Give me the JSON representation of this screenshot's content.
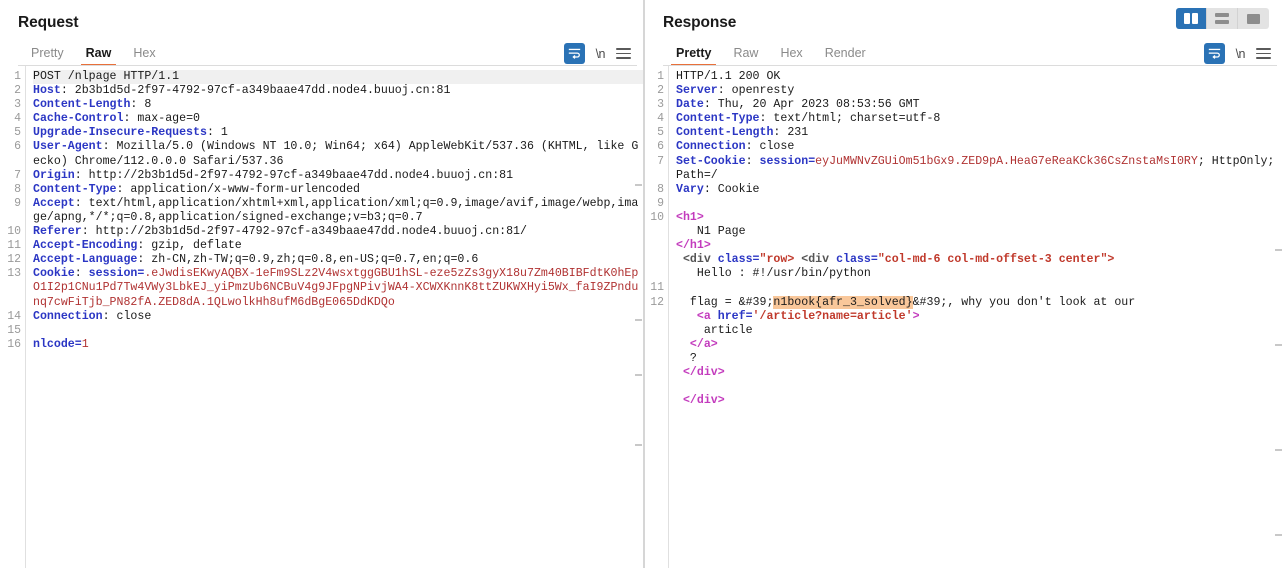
{
  "layout_switch": {
    "buttons": [
      {
        "name": "side-by-side",
        "icon": "columns-icon",
        "active": true
      },
      {
        "name": "stacked",
        "icon": "rows-icon",
        "active": false
      },
      {
        "name": "single",
        "icon": "single-pane-icon",
        "active": false
      }
    ]
  },
  "request": {
    "title": "Request",
    "tabs": [
      {
        "label": "Pretty",
        "active": false
      },
      {
        "label": "Raw",
        "active": true
      },
      {
        "label": "Hex",
        "active": false
      }
    ],
    "tools": [
      {
        "name": "word-wrap-icon",
        "label": ""
      },
      {
        "name": "newline-icon",
        "label": "\\n"
      },
      {
        "name": "menu-icon",
        "label": ""
      }
    ],
    "line_numbers": [
      "1",
      "2",
      "3",
      "4",
      "5",
      "",
      "6",
      "",
      "",
      "7",
      "",
      "8",
      "9",
      "",
      "",
      "",
      "10",
      "",
      "11",
      "12",
      "13",
      "",
      "",
      "",
      "",
      "14",
      "15",
      "",
      "16"
    ],
    "lines": [
      {
        "n": "1",
        "first": true,
        "parts": [
          {
            "t": "POST /nlpage HTTP/1.1",
            "c": "val"
          }
        ]
      },
      {
        "n": "2",
        "parts": [
          {
            "t": "Host",
            "c": "hdr"
          },
          {
            "t": ": 2b3b1d5d-2f97-4792-97cf-a349baae47dd.node4.buuoj.cn:81",
            "c": "val"
          }
        ]
      },
      {
        "n": "3",
        "parts": [
          {
            "t": "Content-Length",
            "c": "hdr"
          },
          {
            "t": ": 8",
            "c": "val"
          }
        ]
      },
      {
        "n": "4",
        "parts": [
          {
            "t": "Cache-Control",
            "c": "hdr"
          },
          {
            "t": ": max-age=0",
            "c": "val"
          }
        ]
      },
      {
        "n": "5",
        "parts": [
          {
            "t": "Upgrade-Insecure-Requests",
            "c": "hdr"
          },
          {
            "t": ": 1",
            "c": "val"
          }
        ]
      },
      {
        "n": "6",
        "parts": [
          {
            "t": "User-Agent",
            "c": "hdr"
          },
          {
            "t": ": Mozilla/5.0 (Windows NT 10.0; Win64; x64) AppleWebKit/537.36 (KHTML, like Gecko) Chrome/112.0.0.0 Safari/537.36",
            "c": "val"
          }
        ]
      },
      {
        "n": "7",
        "parts": [
          {
            "t": "Origin",
            "c": "hdr"
          },
          {
            "t": ": http://2b3b1d5d-2f97-4792-97cf-a349baae47dd.node4.buuoj.cn:81",
            "c": "val"
          }
        ]
      },
      {
        "n": "8",
        "parts": [
          {
            "t": "Content-Type",
            "c": "hdr"
          },
          {
            "t": ": application/x-www-form-urlencoded",
            "c": "val"
          }
        ]
      },
      {
        "n": "9",
        "parts": [
          {
            "t": "Accept",
            "c": "hdr"
          },
          {
            "t": ": text/html,application/xhtml+xml,application/xml;q=0.9,image/avif,image/webp,image/apng,*/*;q=0.8,application/signed-exchange;v=b3;q=0.7",
            "c": "val"
          }
        ]
      },
      {
        "n": "10",
        "parts": [
          {
            "t": "Referer",
            "c": "hdr"
          },
          {
            "t": ": http://2b3b1d5d-2f97-4792-97cf-a349baae47dd.node4.buuoj.cn:81/",
            "c": "val"
          }
        ]
      },
      {
        "n": "11",
        "parts": [
          {
            "t": "Accept-Encoding",
            "c": "hdr"
          },
          {
            "t": ": gzip, deflate",
            "c": "val"
          }
        ]
      },
      {
        "n": "12",
        "parts": [
          {
            "t": "Accept-Language",
            "c": "hdr"
          },
          {
            "t": ": zh-CN,zh-TW;q=0.9,zh;q=0.8,en-US;q=0.7,en;q=0.6",
            "c": "val"
          }
        ]
      },
      {
        "n": "13",
        "parts": [
          {
            "t": "Cookie",
            "c": "hdr"
          },
          {
            "t": ": ",
            "c": "val"
          },
          {
            "t": "session=",
            "c": "hdr"
          },
          {
            "t": ".eJwdisEKwyAQBX-1eFm9SLz2V4wsxtggGBU1hSL-eze5zZs3gyX18u7Zm40BIBFdtK0hEpO1I2p1CNu1Pd7Tw4VWy3LbkEJ_yiPmzUb6NCBuV4g9JFpgNPivjWA4-XCWXKnnK8ttZUKWXHyi5Wx_faI9ZPndunq7cwFiTjb_PN82fA.ZED8dA.1QLwolkHh8ufM6dBgE065DdKDQo",
            "c": "red"
          }
        ]
      },
      {
        "n": "14",
        "parts": [
          {
            "t": "Connection",
            "c": "hdr"
          },
          {
            "t": ": close",
            "c": "val"
          }
        ]
      },
      {
        "n": "15",
        "parts": [
          {
            "t": "",
            "c": "val"
          }
        ]
      },
      {
        "n": "16",
        "parts": [
          {
            "t": "nlcode=",
            "c": "hdr"
          },
          {
            "t": "1",
            "c": "red"
          }
        ]
      }
    ]
  },
  "response": {
    "title": "Response",
    "tabs": [
      {
        "label": "Pretty",
        "active": true
      },
      {
        "label": "Raw",
        "active": false
      },
      {
        "label": "Hex",
        "active": false
      },
      {
        "label": "Render",
        "active": false
      }
    ],
    "tools": [
      {
        "name": "word-wrap-icon",
        "label": ""
      },
      {
        "name": "newline-icon",
        "label": "\\n"
      },
      {
        "name": "menu-icon",
        "label": ""
      }
    ],
    "lines": [
      {
        "n": "1",
        "parts": [
          {
            "t": "HTTP/1.1 200 OK",
            "c": "val"
          }
        ]
      },
      {
        "n": "2",
        "parts": [
          {
            "t": "Server",
            "c": "hdr"
          },
          {
            "t": ": openresty",
            "c": "val"
          }
        ]
      },
      {
        "n": "3",
        "parts": [
          {
            "t": "Date",
            "c": "hdr"
          },
          {
            "t": ": Thu, 20 Apr 2023 08:53:56 GMT",
            "c": "val"
          }
        ]
      },
      {
        "n": "4",
        "parts": [
          {
            "t": "Content-Type",
            "c": "hdr"
          },
          {
            "t": ": text/html; charset=utf-8",
            "c": "val"
          }
        ]
      },
      {
        "n": "5",
        "parts": [
          {
            "t": "Content-Length",
            "c": "hdr"
          },
          {
            "t": ": 231",
            "c": "val"
          }
        ]
      },
      {
        "n": "6",
        "parts": [
          {
            "t": "Connection",
            "c": "hdr"
          },
          {
            "t": ": close",
            "c": "val"
          }
        ]
      },
      {
        "n": "7",
        "parts": [
          {
            "t": "Set-Cookie",
            "c": "hdr"
          },
          {
            "t": ": ",
            "c": "val"
          },
          {
            "t": "session=",
            "c": "hdr"
          },
          {
            "t": "eyJuMWNvZGUiOm51bGx9.ZED9pA.HeaG7eReaKCk36CsZnstaMsI0RY",
            "c": "red"
          },
          {
            "t": "; HttpOnly; Path=/",
            "c": "val"
          }
        ]
      },
      {
        "n": "8",
        "parts": [
          {
            "t": "Vary",
            "c": "hdr"
          },
          {
            "t": ": Cookie",
            "c": "val"
          }
        ]
      },
      {
        "n": "9",
        "parts": [
          {
            "t": "",
            "c": "val"
          }
        ]
      },
      {
        "n": "10",
        "parts": [
          {
            "t": "<h1>",
            "c": "tag"
          }
        ]
      },
      {
        "n": "",
        "parts": [
          {
            "t": "   N1 Page",
            "c": "val"
          }
        ]
      },
      {
        "n": "",
        "parts": [
          {
            "t": "</h1>",
            "c": "tag"
          }
        ]
      },
      {
        "n": "",
        "parts": [
          {
            "t": " <div ",
            "c": "punct"
          },
          {
            "t": "class=",
            "c": "attr"
          },
          {
            "t": "\"row> ",
            "c": "str"
          },
          {
            "t": "<div ",
            "c": "punct"
          },
          {
            "t": "class=",
            "c": "attr"
          },
          {
            "t": "\"col-md-6 col-md-offset-3 center\">",
            "c": "str"
          }
        ]
      },
      {
        "n": "",
        "parts": [
          {
            "t": "   Hello : #!/usr/bin/python",
            "c": "val"
          }
        ]
      },
      {
        "n": "11",
        "parts": [
          {
            "t": "",
            "c": "val"
          }
        ]
      },
      {
        "n": "12",
        "parts": [
          {
            "t": "  flag = &#39;",
            "c": "val"
          },
          {
            "t": "n1book{afr_3_solved}",
            "c": "val",
            "hl": true
          },
          {
            "t": "&#39;, why you don't look at our",
            "c": "val"
          }
        ]
      },
      {
        "n": "",
        "parts": [
          {
            "t": "   <a ",
            "c": "tag"
          },
          {
            "t": "href=",
            "c": "attr"
          },
          {
            "t": "'/article?name=article'",
            "c": "str"
          },
          {
            "t": ">",
            "c": "tag"
          }
        ]
      },
      {
        "n": "",
        "parts": [
          {
            "t": "    article",
            "c": "val"
          }
        ]
      },
      {
        "n": "",
        "parts": [
          {
            "t": "  </a>",
            "c": "tag"
          }
        ]
      },
      {
        "n": "",
        "parts": [
          {
            "t": "  ?",
            "c": "val"
          }
        ]
      },
      {
        "n": "",
        "parts": [
          {
            "t": " </div>",
            "c": "tag"
          }
        ]
      },
      {
        "n": "",
        "parts": [
          {
            "t": "",
            "c": "val"
          }
        ]
      },
      {
        "n": "",
        "parts": [
          {
            "t": " </div>",
            "c": "tag"
          }
        ]
      }
    ]
  },
  "colors": {
    "accent_orange": "#e8703a",
    "accent_blue": "#2a72b5",
    "header_blue": "#2b36c4",
    "string_red": "#c0392b",
    "tag_magenta": "#c33bbd",
    "highlight": "#f9c79a"
  }
}
